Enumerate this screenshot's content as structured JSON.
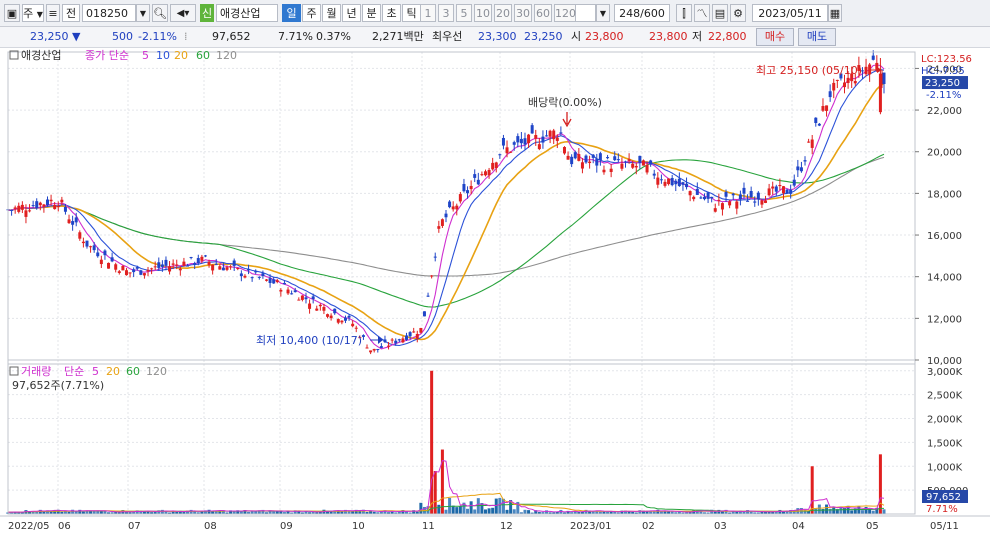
{
  "toolbar": {
    "period_label": "주",
    "chart_type_label": "전",
    "stock_code": "018250",
    "badge_label": "신",
    "stock_name": "애경산업",
    "periods": [
      "일",
      "주",
      "월",
      "년",
      "분",
      "초",
      "틱"
    ],
    "active_period": "일",
    "intervals": [
      "1",
      "3",
      "5",
      "10",
      "20",
      "30",
      "60",
      "120"
    ],
    "count": "248/600",
    "date": "2023/05/11"
  },
  "info": {
    "price": "23,250",
    "change": "500",
    "change_pct": "-2.11%",
    "volume": "97,652",
    "turnover": "7.71%",
    "vol_ratio": "0.37%",
    "amount": "2,271백만",
    "priority_label": "최우선",
    "ask": "23,300",
    "bid": "23,250",
    "open_label": "시",
    "open": "23,800",
    "high": "23,800",
    "low_label": "저",
    "low": "22,800",
    "buy_label": "매수",
    "sell_label": "매도"
  },
  "legend": {
    "name": "애경산업",
    "price_ma_prefix": "종가 단순",
    "volume_title": "거래량",
    "volume_ma_prefix": "단순",
    "ma_periods": [
      "5",
      "10",
      "20",
      "60",
      "120"
    ],
    "ma_colors": [
      "#cf2fcf",
      "#2c52d8",
      "#e8a213",
      "#28a33c",
      "#8e8e8e"
    ],
    "volume_value": "97,652주(7.71%)"
  },
  "colors": {
    "up": "#e02020",
    "down": "#1f45c8",
    "volume_bar": "#1c68a8",
    "current_price_bg": "#2648a8"
  },
  "annotations": {
    "high": "최고 25,150 (05/10)",
    "low": "최저 10,400 (10/17)",
    "ex_dividend": "배당락(0.00%)",
    "lc": "LC:123.56",
    "hc": "HC:-7.55"
  },
  "y_axis": {
    "price_ticks": [
      "24,000",
      "22,000",
      "20,000",
      "18,000",
      "16,000",
      "14,000",
      "12,000",
      "10,000"
    ],
    "current_price": "23,250",
    "current_change": "-2.11%",
    "volume_ticks": [
      "3,000K",
      "2,500K",
      "2,000K",
      "1,500K",
      "1,000K",
      "500,000"
    ],
    "current_volume": "97,652",
    "current_volume_pct": "7.71%"
  },
  "x_axis": {
    "labels": [
      "2022/05",
      "06",
      "07",
      "08",
      "09",
      "10",
      "11",
      "12",
      "2023/01",
      "02",
      "03",
      "04",
      "05"
    ],
    "right_label": "05/11"
  },
  "chart_data": {
    "type": "candlestick",
    "range": "2022/05 – 2023/05/11",
    "price_ylim": [
      10000,
      24500
    ],
    "volume_ylim": [
      0,
      3100000
    ],
    "price_anchors": [
      {
        "date": "2022/05",
        "close": 17200
      },
      {
        "date": "2022/06",
        "close": 17700
      },
      {
        "date": "2022/06 mid",
        "close": 15500
      },
      {
        "date": "2022/07",
        "close": 14200
      },
      {
        "date": "2022/08",
        "close": 14800
      },
      {
        "date": "2022/09",
        "close": 13600
      },
      {
        "date": "2022/10",
        "close": 11800
      },
      {
        "date": "2022/10/17",
        "close": 10400
      },
      {
        "date": "2022/11",
        "close": 11500
      },
      {
        "date": "2022/11 mid",
        "close": 16500
      },
      {
        "date": "2022/12",
        "close": 20000
      },
      {
        "date": "2022/12 late",
        "close": 21000
      },
      {
        "date": "2023/01",
        "close": 19600
      },
      {
        "date": "2023/02",
        "close": 19300
      },
      {
        "date": "2023/03",
        "close": 17500
      },
      {
        "date": "2023/04",
        "close": 18200
      },
      {
        "date": "2023/04 mid",
        "close": 22800
      },
      {
        "date": "2023/05/10",
        "close": 24500
      },
      {
        "date": "2023/05/11",
        "close": 23250
      }
    ],
    "volume_spikes": [
      {
        "date": "2022/11",
        "volume": 3000000
      },
      {
        "date": "2022/11",
        "volume": 1350000
      },
      {
        "date": "2022/11",
        "volume": 900000
      },
      {
        "date": "2023/04",
        "volume": 1000000
      },
      {
        "date": "2023/05/10",
        "volume": 1250000
      }
    ]
  }
}
